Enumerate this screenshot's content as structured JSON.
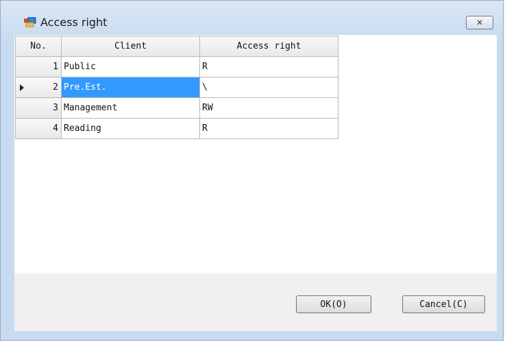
{
  "window": {
    "title": "Access right",
    "icon": "window-app-icon",
    "close_icon": "close-icon"
  },
  "grid": {
    "columns": [
      "No.",
      "Client",
      "Access right"
    ],
    "rows": [
      {
        "no": "1",
        "client": "Public",
        "access": "R"
      },
      {
        "no": "2",
        "client": "Pre.Est.",
        "access": "\\"
      },
      {
        "no": "3",
        "client": "Management",
        "access": "RW"
      },
      {
        "no": "4",
        "client": "Reading",
        "access": "R"
      }
    ],
    "selected_row": 2
  },
  "buttons": {
    "ok": "OK(O)",
    "cancel": "Cancel(C)"
  },
  "colors": {
    "selection": "#3399ff",
    "title_bar": "#d9e6f6"
  }
}
